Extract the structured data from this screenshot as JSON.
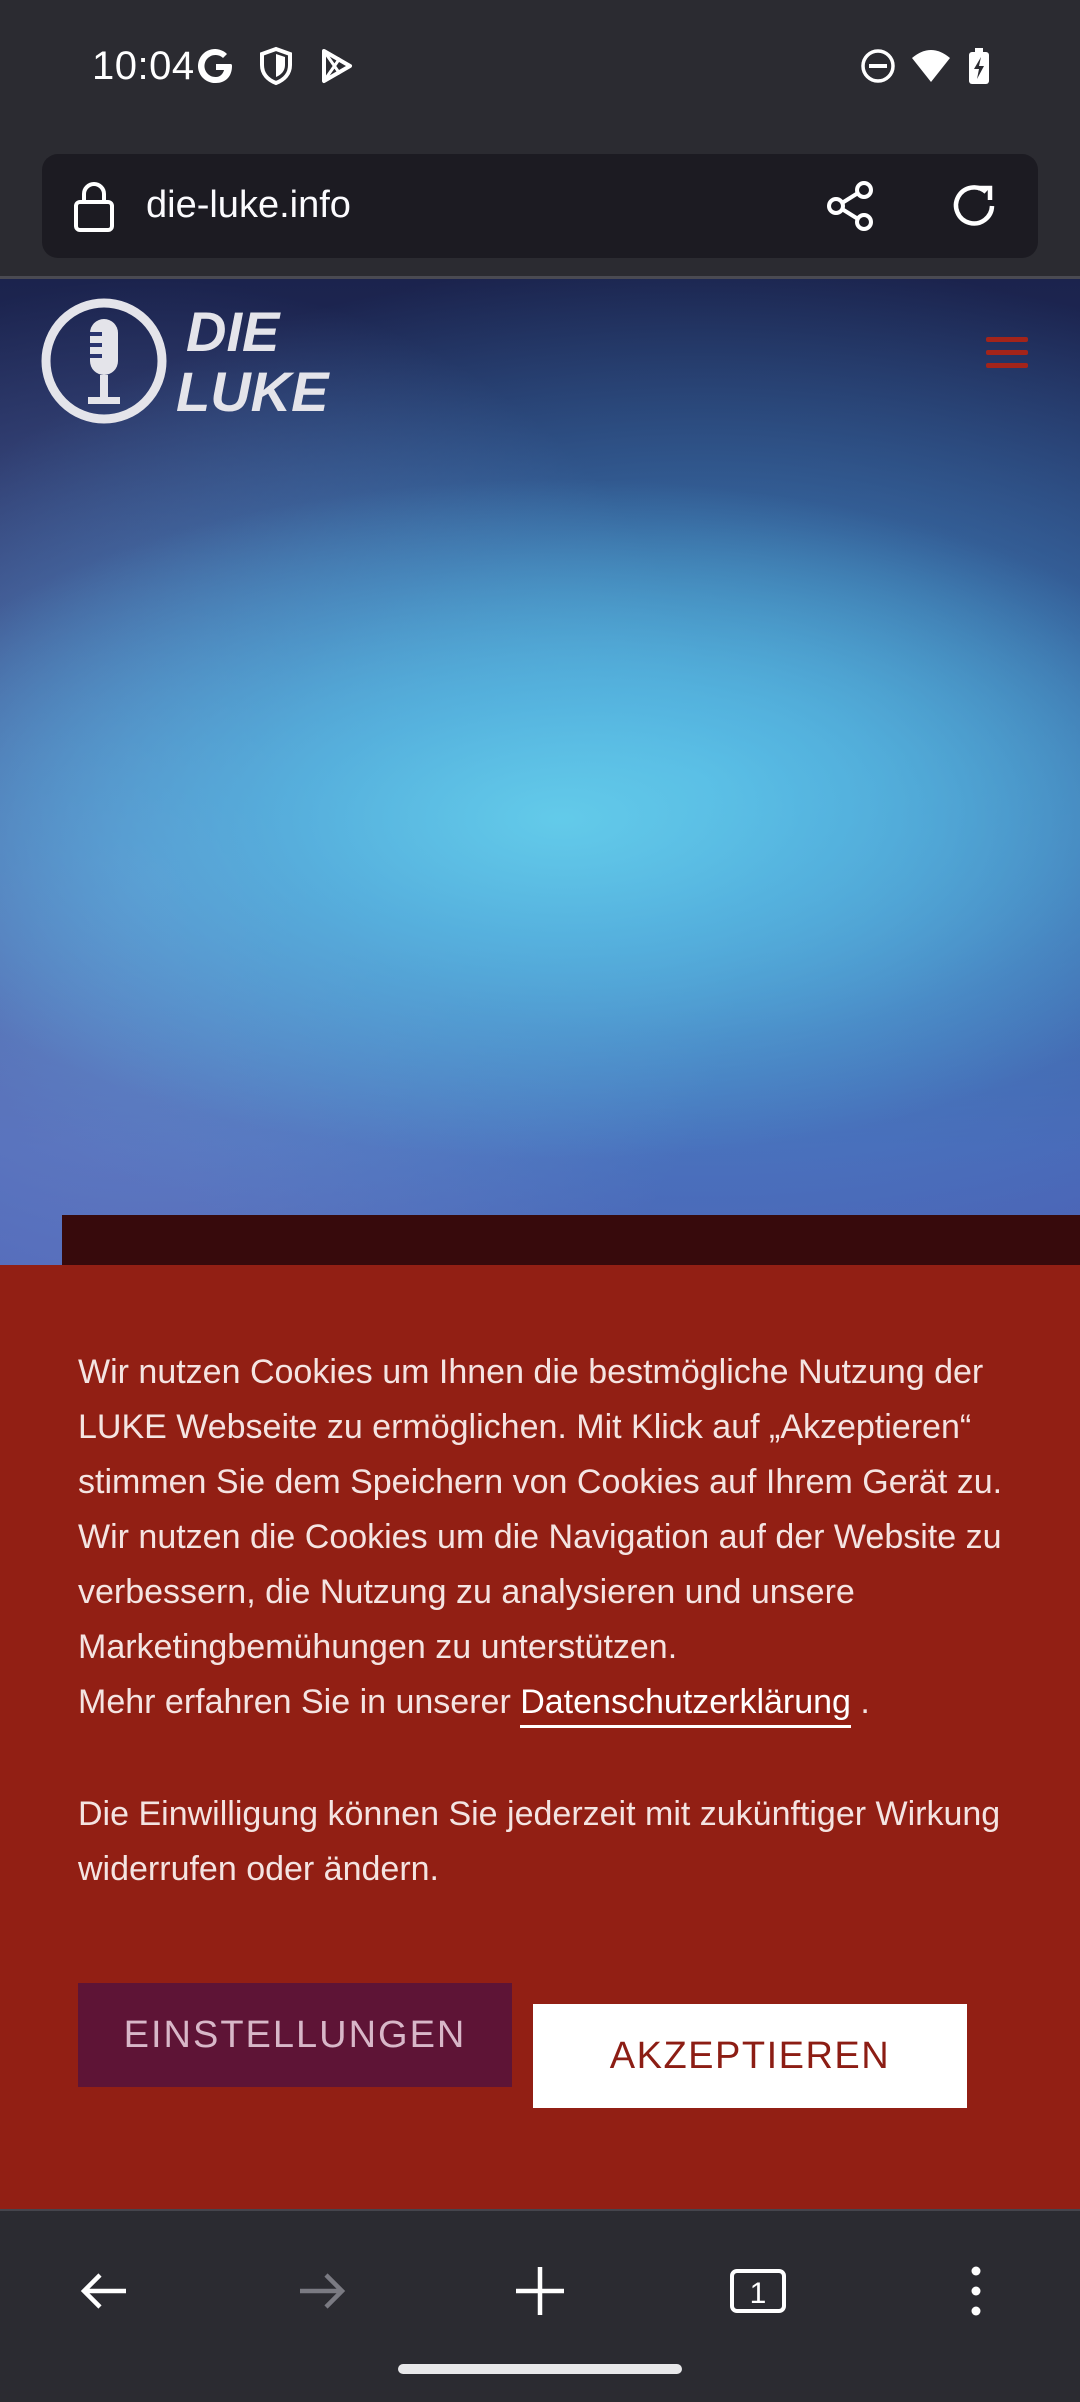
{
  "status_bar": {
    "time": "10:04",
    "icons": [
      "google-icon",
      "shield-icon",
      "play-store-icon",
      "dnd-icon",
      "wifi-icon",
      "battery-charging-icon"
    ]
  },
  "browser": {
    "url": "die-luke.info",
    "tab_count": "1"
  },
  "site": {
    "logo_line1": "DIE",
    "logo_line2": "LUKE"
  },
  "cookie_banner": {
    "para1": "Wir nutzen Cookies um Ihnen die bestmögliche Nutzung der LUKE Webseite zu ermöglichen. Mit Klick auf „Akzeptieren“ stimmen Sie dem Speichern von Cookies auf Ihrem Gerät zu.",
    "para2": "Wir nutzen die Cookies um die Navigation auf der Website zu verbessern, die Nutzung zu analysieren und unsere Marketingbemühungen zu unterstützen.",
    "para3_prefix": "Mehr erfahren Sie in unserer ",
    "privacy_link": "Datenschutzerklärung",
    "para3_suffix": " .",
    "para4": "Die Einwilligung können Sie jederzeit mit zukünftiger Wirkung widerrufen oder ändern.",
    "settings_label": "EINSTELLUNGEN",
    "accept_label": "AKZEPTIEREN"
  },
  "colors": {
    "banner_bg": "#921f14",
    "settings_bg": "#5e1436",
    "accent_red": "#a3241a"
  }
}
